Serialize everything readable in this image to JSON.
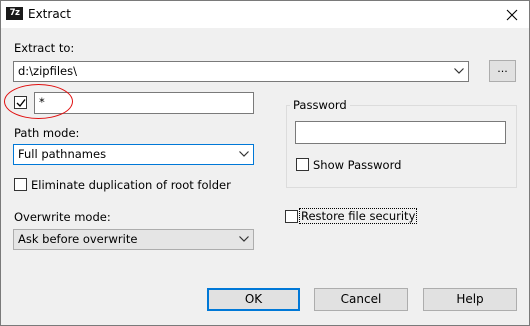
{
  "window": {
    "title": "Extract",
    "app_icon": "7z"
  },
  "extract_to": {
    "label": "Extract to:",
    "path": "d:\\zipfiles\\",
    "browse_label": "..."
  },
  "filter": {
    "checked": true,
    "value": "*"
  },
  "path_mode": {
    "label": "Path mode:",
    "value": "Full pathnames"
  },
  "eliminate_duplication": {
    "label": "Eliminate duplication of root folder",
    "checked": false
  },
  "overwrite_mode": {
    "label": "Overwrite mode:",
    "value": "Ask before overwrite"
  },
  "password": {
    "group_title": "Password",
    "value": "",
    "show_password_label": "Show Password",
    "show_password_checked": false
  },
  "restore_security": {
    "label": "Restore file security",
    "checked": false
  },
  "buttons": {
    "ok": "OK",
    "cancel": "Cancel",
    "help": "Help"
  },
  "colors": {
    "annotation": "#e01010",
    "focus": "#0078d7",
    "combo_active_border": "#0078d7",
    "combo_active_bg": "#ffffff",
    "combo_inactive_bg": "#e5e5e5"
  },
  "icons": {
    "close": "close-icon",
    "dropdown": "chevron-down-icon",
    "check": "checkmark-icon"
  }
}
